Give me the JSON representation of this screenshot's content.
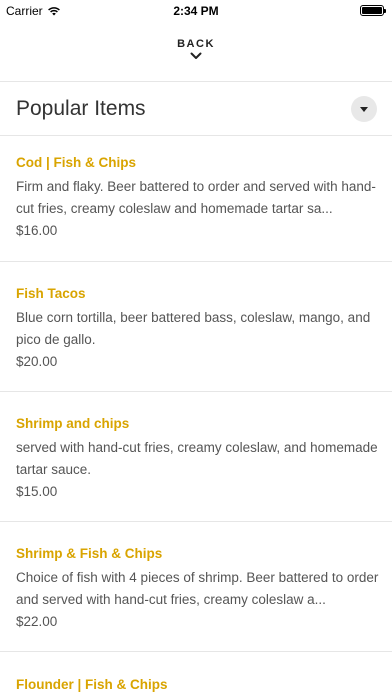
{
  "status_bar": {
    "carrier": "Carrier",
    "time": "2:34 PM",
    "icons": [
      "wifi-icon",
      "battery-icon"
    ]
  },
  "nav": {
    "back_label": "BACK",
    "icon": "chevron-down-icon"
  },
  "section": {
    "title": "Popular Items",
    "toggle_icon": "triangle-down-icon"
  },
  "items": [
    {
      "name": "Cod | Fish & Chips",
      "description": "Firm and flaky. Beer battered to order and served with hand-cut fries, creamy coleslaw and homemade tartar sa...",
      "price": "$16.00"
    },
    {
      "name": "Fish Tacos",
      "description": "Blue corn tortilla, beer battered bass, coleslaw, mango, and pico de gallo.",
      "price": "$20.00"
    },
    {
      "name": "Shrimp and chips",
      "description": "served with hand-cut fries, creamy coleslaw, and homemade tartar sauce.",
      "price": "$15.00"
    },
    {
      "name": "Shrimp & Fish & Chips",
      "description": "Choice of fish with 4 pieces of shrimp. Beer battered to order and served with hand-cut fries, creamy coleslaw a...",
      "price": "$22.00"
    },
    {
      "name": "Flounder | Fish & Chips",
      "description": "",
      "price": ""
    }
  ],
  "colors": {
    "item_name": "#d9a400",
    "text": "#555555",
    "divider": "#e6e6e6",
    "toggle_bg": "#e8e8e8"
  }
}
